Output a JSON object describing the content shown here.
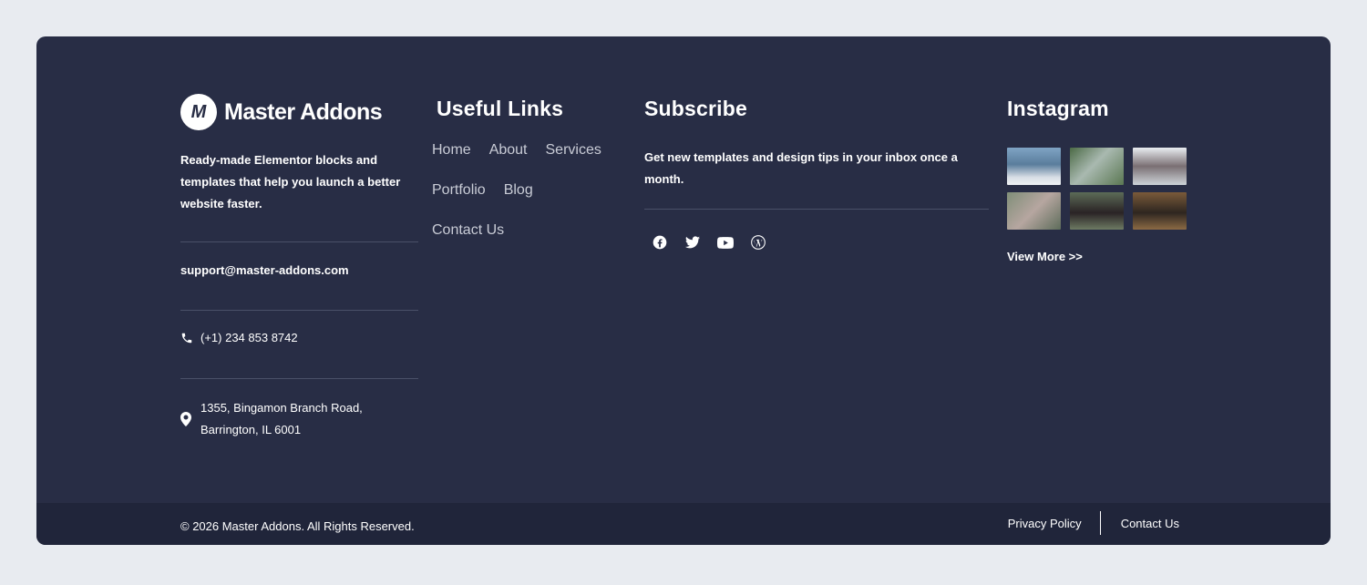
{
  "brand": {
    "logo_mark": "M",
    "name": "Master Addons",
    "tagline": "Ready-made Elementor blocks and templates that help you launch a better website faster."
  },
  "contact": {
    "email": "support@master-addons.com",
    "phone": "(+1) 234 853 8742",
    "address_line1": "1355, Bingamon Branch Road,",
    "address_line2": "Barrington, IL 6001"
  },
  "useful_links": {
    "heading": "Useful Links",
    "items": [
      "Home",
      "About",
      "Services",
      "Portfolio",
      "Blog",
      "Contact Us"
    ]
  },
  "subscribe": {
    "heading": "Subscribe",
    "text": "Get new templates and design tips in your inbox once a month.",
    "social_icons": [
      "facebook-icon",
      "twitter-icon",
      "youtube-icon",
      "wordpress-icon"
    ]
  },
  "instagram": {
    "heading": "Instagram",
    "view_more": "View More >>"
  },
  "bottom_bar": {
    "copyright": "© 2026 Master Addons. All Rights Reserved.",
    "privacy": "Privacy Policy",
    "contact": "Contact Us"
  },
  "colors": {
    "page_bg": "#e8ebf0",
    "footer_bg": "#282d45",
    "bottom_bar_bg": "#20253a",
    "divider": "#4a5068",
    "link_text": "#c9ccd6"
  }
}
